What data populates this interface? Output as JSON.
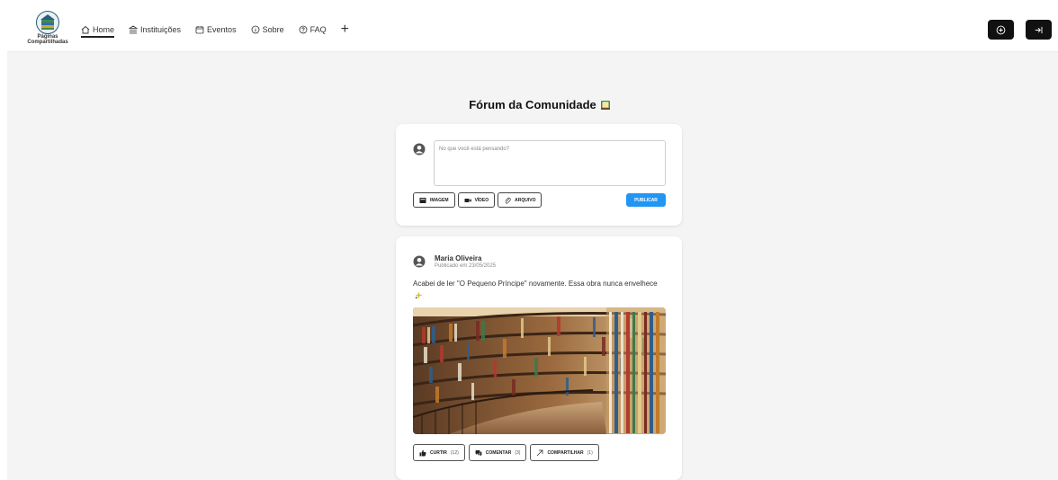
{
  "brand": {
    "line1": "Páginas",
    "line2": "Compartilhadas"
  },
  "nav": {
    "items": [
      {
        "label": "Home",
        "icon": "home-icon",
        "active": true
      },
      {
        "label": "Instituições",
        "icon": "institution-icon",
        "active": false
      },
      {
        "label": "Eventos",
        "icon": "calendar-icon",
        "active": false
      },
      {
        "label": "Sobre",
        "icon": "info-icon",
        "active": false
      },
      {
        "label": "FAQ",
        "icon": "help-icon",
        "active": false
      }
    ],
    "plus": "+"
  },
  "header_buttons": {
    "left_icon": "add-circle-icon",
    "right_icon": "login-icon"
  },
  "forum": {
    "title": "Fórum da Comunidade",
    "title_emoji": "book-emoji"
  },
  "composer": {
    "placeholder": "No que você está pensando?",
    "image_label": "IMAGEM",
    "video_label": "VÍDEO",
    "file_label": "ARQUIVO",
    "publish_label": "PUBLICAR"
  },
  "post": {
    "author": "Maria Oliveira",
    "date": "Publicado em 23/05/2025",
    "text": "Acabei de ler \"O Pequeno Príncipe\" novamente. Essa obra nunca envelhece",
    "like_label": "CURTIR",
    "like_count": "(12)",
    "comment_label": "COMENTAR",
    "comment_count": "(3)",
    "share_label": "COMPARTILHAR",
    "share_count": "(1)"
  },
  "colors": {
    "accent": "#2196f3",
    "dark": "#111111",
    "background": "#f4f4f4"
  }
}
